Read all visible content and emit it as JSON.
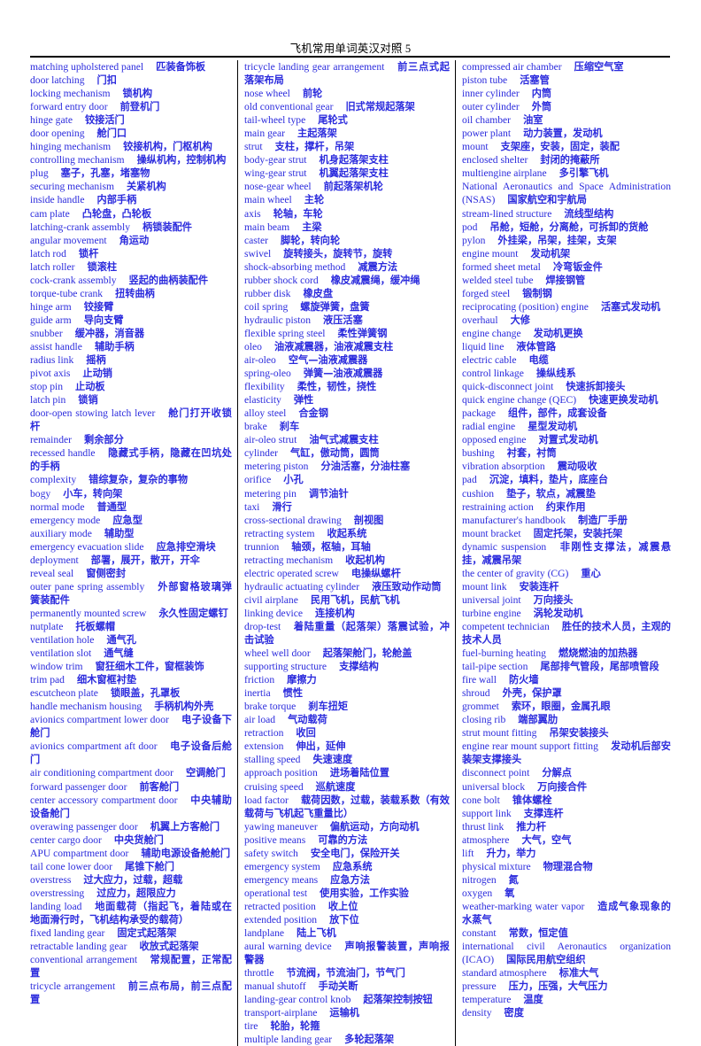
{
  "document": {
    "title": "飞机常用单词英汉对照 5",
    "text_color": "#2b2bdd",
    "title_color": "#000000",
    "background_color": "#ffffff",
    "rule_color": "#000000"
  },
  "columns": [
    {
      "id": "column-left",
      "entries": [
        {
          "en": "matching upholstered panel",
          "zh": "匹装备饰板"
        },
        {
          "en": "door latching",
          "zh": "门扣"
        },
        {
          "en": "locking mechanism",
          "zh": "锁机构"
        },
        {
          "en": "forward entry door",
          "zh": "前登机门"
        },
        {
          "en": "hinge gate",
          "zh": "铰接活门"
        },
        {
          "en": "door opening",
          "zh": "舱门口"
        },
        {
          "en": "hinging mechanism",
          "zh": "铰接机构，门枢机构"
        },
        {
          "en": "controlling  mechanism",
          "zh": "操纵机构，控制机构"
        },
        {
          "en": "plug",
          "zh": "塞子，孔塞，堵塞物"
        },
        {
          "en": "securing mechanism",
          "zh": "关紧机构"
        },
        {
          "en": "inside handle",
          "zh": "内部手柄"
        },
        {
          "en": "cam plate",
          "zh": "凸轮盘，凸轮板"
        },
        {
          "en": "latching-crank assembly",
          "zh": "柄锁装配件"
        },
        {
          "en": "angular movement",
          "zh": "角运动"
        },
        {
          "en": "latch rod",
          "zh": "锁杆"
        },
        {
          "en": "latch roller",
          "zh": "锁滚柱"
        },
        {
          "en": "cock-crank assembly",
          "zh": "竖起的曲柄装配件"
        },
        {
          "en": "torque-tube crank",
          "zh": "扭转曲柄"
        },
        {
          "en": "hinge arm",
          "zh": "铰接臂"
        },
        {
          "en": "guide arm",
          "zh": "导向支臂"
        },
        {
          "en": "snubber",
          "zh": "缓冲器，消音器"
        },
        {
          "en": "assist handle",
          "zh": "辅助手柄"
        },
        {
          "en": "radius link",
          "zh": "摇柄"
        },
        {
          "en": "pivot axis",
          "zh": "止动销"
        },
        {
          "en": "stop pin",
          "zh": "止动板"
        },
        {
          "en": "latch pin",
          "zh": "锁销"
        },
        {
          "en": "door-open  stowing  latch  lever",
          "zh": "舱门打开收锁杆"
        },
        {
          "en": "remainder",
          "zh": "剩余部分"
        },
        {
          "en": "recessed  handle",
          "zh": "隐藏式手柄，隐藏在凹坑处的手柄"
        },
        {
          "en": "complexity",
          "zh": "错综复杂，复杂的事物"
        },
        {
          "en": "bogy",
          "zh": "小车，转向架"
        },
        {
          "en": "normal mode",
          "zh": "普通型"
        },
        {
          "en": "emergency mode",
          "zh": "应急型"
        },
        {
          "en": "auxiliary mode",
          "zh": "辅助型"
        },
        {
          "en": "emergency evacuation slide",
          "zh": "应急排空滑块"
        },
        {
          "en": "deployment",
          "zh": "部署，展开，散开，开伞"
        },
        {
          "en": "reveal seal",
          "zh": "窗侧密封"
        },
        {
          "en": "outer  pane  spring  assembly",
          "zh": "外部窗格玻璃弹簧装配件"
        },
        {
          "en": "permanently  mounted  screw",
          "zh": "永久性固定螺钉"
        },
        {
          "en": "nutplate",
          "zh": "托板螺帽"
        },
        {
          "en": "ventilation hole",
          "zh": "通气孔"
        },
        {
          "en": "ventilation slot",
          "zh": "通气缝"
        },
        {
          "en": "window trim",
          "zh": "窗狂细木工件，窗框装饰"
        },
        {
          "en": "trim pad",
          "zh": "细木窗框衬垫"
        },
        {
          "en": "escutcheon plate",
          "zh": "锁眼盖，孔罩板"
        },
        {
          "en": "handle mechanism housing",
          "zh": "手柄机构外壳"
        },
        {
          "en": "avionics compartment lower door",
          "zh": "电子设备下舱门"
        },
        {
          "en": "avionics  compartment  aft  door",
          "zh": "电子设备后舱门"
        },
        {
          "en": "air  conditioning  compartment  door",
          "zh": "空调舱门"
        },
        {
          "en": "forward passenger door",
          "zh": "前客舱门"
        },
        {
          "en": "center  accessory  compartment  door",
          "zh": "中央辅助设备舱门"
        },
        {
          "en": "overawing passenger door",
          "zh": "机翼上方客舱门"
        },
        {
          "en": "center cargo door",
          "zh": "中央货舱门"
        },
        {
          "en": "APU compartment door",
          "zh": "辅助电源设备舱舱门"
        },
        {
          "en": "tail cone lower door",
          "zh": "尾锥下舱门"
        },
        {
          "en": "overstress",
          "zh": "过大应力，过载，超载"
        },
        {
          "en": "overstressing",
          "zh": "过应力，超限应力"
        },
        {
          "en": "landing load",
          "zh": "地面载荷（指起飞，着陆或在地面滑行时，飞机结构承受的载荷）"
        },
        {
          "en": "fixed landing gear",
          "zh": "固定式起落架"
        },
        {
          "en": "retractable landing gear",
          "zh": "收放式起落架"
        },
        {
          "en": "conventional  arrangement",
          "zh": "常规配置，正常配置"
        },
        {
          "en": "tricycle  arrangement",
          "zh": "前三点布局，前三点配置"
        }
      ]
    },
    {
      "id": "column-middle",
      "entries": [
        {
          "en": "tricycle landing gear arrangement",
          "zh": "前三点式起落架布局"
        },
        {
          "en": "nose wheel",
          "zh": "前轮"
        },
        {
          "en": "old conventional gear",
          "zh": "旧式常规起落架"
        },
        {
          "en": "tail-wheel type",
          "zh": "尾轮式"
        },
        {
          "en": "main gear",
          "zh": "主起落架"
        },
        {
          "en": "strut",
          "zh": "支柱，撑杆，吊架"
        },
        {
          "en": "body-gear strut",
          "zh": "机身起落架支柱"
        },
        {
          "en": "wing-gear strut",
          "zh": "机翼起落架支柱"
        },
        {
          "en": "nose-gear wheel",
          "zh": "前起落架机轮"
        },
        {
          "en": "main wheel",
          "zh": "主轮"
        },
        {
          "en": "axis",
          "zh": "轮轴，车轮"
        },
        {
          "en": "main beam",
          "zh": "主梁"
        },
        {
          "en": "caster",
          "zh": "脚轮，转向轮"
        },
        {
          "en": "swivel",
          "zh": "旋转接头，旋转节，旋转"
        },
        {
          "en": "shock-absorbing method",
          "zh": "减震方法"
        },
        {
          "en": "rubber shock cord",
          "zh": "橡皮减震绳，缓冲绳"
        },
        {
          "en": "rubber disk",
          "zh": "橡皮盘"
        },
        {
          "en": "coil spring",
          "zh": "螺旋弹簧，盘簧"
        },
        {
          "en": "hydraulic piston",
          "zh": "液压活塞"
        },
        {
          "en": "flexible spring steel",
          "zh": "柔性弹簧钢"
        },
        {
          "en": "oleo",
          "zh": "油液减震器，油液减震支柱"
        },
        {
          "en": "air-oleo",
          "zh": "空气—油液减震器"
        },
        {
          "en": "spring-oleo",
          "zh": "弹簧—油液减震器"
        },
        {
          "en": "flexibility",
          "zh": "柔性，韧性，挠性"
        },
        {
          "en": "elasticity",
          "zh": "弹性"
        },
        {
          "en": "alloy steel",
          "zh": "合金钢"
        },
        {
          "en": "brake",
          "zh": "刹车"
        },
        {
          "en": "air-oleo strut",
          "zh": "油气式减震支柱"
        },
        {
          "en": "cylinder",
          "zh": "气缸，傲动筒，圆筒"
        },
        {
          "en": "metering piston",
          "zh": "分油活塞，分油柱塞"
        },
        {
          "en": "orifice",
          "zh": "小孔"
        },
        {
          "en": "metering pin",
          "zh": "调节油针"
        },
        {
          "en": "taxi",
          "zh": "滑行"
        },
        {
          "en": "cross-sectional drawing",
          "zh": "剖视图"
        },
        {
          "en": "retracting system",
          "zh": "收起系统"
        },
        {
          "en": "trunnion",
          "zh": "轴颈，枢轴，耳轴"
        },
        {
          "en": "retracting mechanism",
          "zh": "收起机构"
        },
        {
          "en": "electric operated screw",
          "zh": "电操纵螺杆"
        },
        {
          "en": "hydraulic  actuating  cylinder",
          "zh": "液压致动作动筒"
        },
        {
          "en": "civil airplane",
          "zh": "民用飞机，民航飞机"
        },
        {
          "en": "linking device",
          "zh": "连接机构"
        },
        {
          "en": "drop-test",
          "zh": "着陆重量（起落架）落震试验，冲击试验"
        },
        {
          "en": "wheel well door",
          "zh": "起落架舱门，轮舱盖"
        },
        {
          "en": "supporting structure",
          "zh": "支撑结构"
        },
        {
          "en": "friction",
          "zh": "摩擦力"
        },
        {
          "en": "inertia",
          "zh": "惯性"
        },
        {
          "en": "brake torque",
          "zh": "刹车扭矩"
        },
        {
          "en": "air load",
          "zh": "气动载荷"
        },
        {
          "en": "retraction",
          "zh": "收回"
        },
        {
          "en": "extension",
          "zh": "伸出，延伸"
        },
        {
          "en": "stalling speed",
          "zh": "失速速度"
        },
        {
          "en": "approach position",
          "zh": "进场着陆位置"
        },
        {
          "en": "cruising speed",
          "zh": "巡航速度"
        },
        {
          "en": "load factor",
          "zh": "载荷因数，过载，装载系数（有效载荷与飞机起飞重量比）"
        },
        {
          "en": "yawing maneuver",
          "zh": "偏航运动，方向动机"
        },
        {
          "en": "positive means",
          "zh": "可靠的方法"
        },
        {
          "en": "safety switch",
          "zh": "安全电门，保险开关"
        },
        {
          "en": "emergency system",
          "zh": "应急系统"
        },
        {
          "en": "emergency means",
          "zh": "应急方法"
        },
        {
          "en": "operational test",
          "zh": "使用实验，工作实验"
        },
        {
          "en": "retracted position",
          "zh": "收上位"
        },
        {
          "en": "extended position",
          "zh": "放下位"
        },
        {
          "en": "landplane",
          "zh": "陆上飞机"
        },
        {
          "en": "aural  warning  device",
          "zh": "声响报警装置，声响报警器"
        },
        {
          "en": "throttle",
          "zh": "节流阀，节流油门，节气门"
        },
        {
          "en": "manual shutoff",
          "zh": "手动关断"
        },
        {
          "en": "landing-gear control knob",
          "zh": "起落架控制按钮"
        },
        {
          "en": "transport-airplane",
          "zh": "运输机"
        },
        {
          "en": "tire",
          "zh": "轮胎，轮箍"
        },
        {
          "en": "multiple landing gear",
          "zh": "多轮起落架"
        }
      ]
    },
    {
      "id": "column-right",
      "entries": [
        {
          "en": "compressed air chamber",
          "zh": "压缩空气室"
        },
        {
          "en": "piston tube",
          "zh": "活塞管"
        },
        {
          "en": "inner cylinder",
          "zh": "内筒"
        },
        {
          "en": "outer cylinder",
          "zh": "外筒"
        },
        {
          "en": "oil chamber",
          "zh": "油室"
        },
        {
          "en": "power plant",
          "zh": "动力装置，发动机"
        },
        {
          "en": "mount",
          "zh": "支架座，安装，固定，装配"
        },
        {
          "en": "enclosed shelter",
          "zh": "封闭的掩蔽所"
        },
        {
          "en": "multiengine airplane",
          "zh": "多引擎飞机"
        },
        {
          "en": "National Aeronautics and Space Administration (NSAS)",
          "zh": "国家航空和宇航局"
        },
        {
          "en": "stream-lined structure",
          "zh": "流线型结构"
        },
        {
          "en": "pod",
          "zh": "吊舱，短舱，分离舱，可拆卸的货舱"
        },
        {
          "en": "pylon",
          "zh": "外挂梁，吊架，挂架，支架"
        },
        {
          "en": "engine mount",
          "zh": "发动机架"
        },
        {
          "en": "formed sheet metal",
          "zh": "冷弯钣金件"
        },
        {
          "en": "welded steel tube",
          "zh": "焊接钢管"
        },
        {
          "en": "forged steel",
          "zh": "锻制钢"
        },
        {
          "en": "reciprocating (position) engine",
          "zh": "活塞式发动机"
        },
        {
          "en": "overhaul",
          "zh": "大修"
        },
        {
          "en": "engine change",
          "zh": "发动机更换"
        },
        {
          "en": "liquid line",
          "zh": "液体管路"
        },
        {
          "en": "electric cable",
          "zh": "电缆"
        },
        {
          "en": "control linkage",
          "zh": "操纵线系"
        },
        {
          "en": "quick-disconnect joint",
          "zh": "快速拆卸接头"
        },
        {
          "en": "quick  engine  change  (QEC)",
          "zh": "快速更换发动机"
        },
        {
          "en": "package",
          "zh": "组件，部件，成套设备"
        },
        {
          "en": "radial engine",
          "zh": "星型发动机"
        },
        {
          "en": "opposed engine",
          "zh": "对置式发动机"
        },
        {
          "en": "bushing",
          "zh": "衬套，衬筒"
        },
        {
          "en": "vibration absorption",
          "zh": "震动吸收"
        },
        {
          "en": "pad",
          "zh": "沉淀，填料，垫片，底座台"
        },
        {
          "en": "cushion",
          "zh": "垫子，软点，减震垫"
        },
        {
          "en": "restraining action",
          "zh": "约束作用"
        },
        {
          "en": "manufacturer's handbook",
          "zh": "制造厂手册"
        },
        {
          "en": "mount bracket",
          "zh": "固定托架，安装托架"
        },
        {
          "en": "dynamic suspension",
          "zh": "非刚性支撑法，减震悬挂，减震吊架"
        },
        {
          "en": "the center of gravity (CG)",
          "zh": "重心"
        },
        {
          "en": "mount link",
          "zh": "安装连杆"
        },
        {
          "en": "universal joint",
          "zh": "万向接头"
        },
        {
          "en": "turbine engine",
          "zh": "涡轮发动机"
        },
        {
          "en": "competent technician",
          "zh": "胜任的技术人员，主观的技术人员"
        },
        {
          "en": "fuel-burning heating",
          "zh": "燃烧燃油的加热器"
        },
        {
          "en": "tail-pipe  section",
          "zh": "尾部排气管段，尾部喷管段"
        },
        {
          "en": "fire wall",
          "zh": "防火墙"
        },
        {
          "en": "shroud",
          "zh": "外壳，保护罩"
        },
        {
          "en": "grommet",
          "zh": "索环，眼圈，金属孔眼"
        },
        {
          "en": "closing rib",
          "zh": "端部翼肋"
        },
        {
          "en": "strut mount fitting",
          "zh": "吊架安装接头"
        },
        {
          "en": "engine rear mount support fitting",
          "zh": "发动机后部安装架支撑接头"
        },
        {
          "en": "disconnect point",
          "zh": "分解点"
        },
        {
          "en": "universal block",
          "zh": "万向接合件"
        },
        {
          "en": "cone bolt",
          "zh": "锥体螺栓"
        },
        {
          "en": "support link",
          "zh": "支撑连杆"
        },
        {
          "en": "thrust link",
          "zh": "推力杆"
        },
        {
          "en": "atmosphere",
          "zh": "大气，空气"
        },
        {
          "en": "lift",
          "zh": "升力，举力"
        },
        {
          "en": "physical mixture",
          "zh": "物理混合物"
        },
        {
          "en": "nitrogen",
          "zh": "氮"
        },
        {
          "en": "oxygen",
          "zh": "氧"
        },
        {
          "en": "weather-marking  water  vapor",
          "zh": "造成气象现象的水蒸气"
        },
        {
          "en": "constant",
          "zh": "常数，恒定值"
        },
        {
          "en": "international  civil  Aeronautics  organization (ICAO)",
          "zh": "国际民用航空组织"
        },
        {
          "en": "standard atmosphere",
          "zh": "标准大气"
        },
        {
          "en": "pressure",
          "zh": "压力，压强，大气压力"
        },
        {
          "en": "temperature",
          "zh": "温度"
        },
        {
          "en": "density",
          "zh": "密度"
        }
      ]
    }
  ]
}
